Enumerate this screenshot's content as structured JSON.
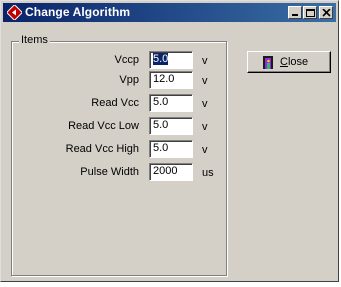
{
  "window": {
    "title": "Change Algorithm",
    "buttons": {
      "minimize": "minimize",
      "maximize": "maximize",
      "close": "close"
    }
  },
  "group": {
    "label": "Items",
    "rows": [
      {
        "label": "Vccp",
        "value": "5.0",
        "unit": "v",
        "selected": true
      },
      {
        "label": "Vpp",
        "value": "12.0",
        "unit": "v",
        "selected": false
      },
      {
        "label": "Read Vcc",
        "value": "5.0",
        "unit": "v",
        "selected": false
      },
      {
        "label": "Read Vcc Low",
        "value": "5.0",
        "unit": "v",
        "selected": false
      },
      {
        "label": "Read Vcc High",
        "value": "5.0",
        "unit": "v",
        "selected": false
      },
      {
        "label": "Pulse Width",
        "value": "2000",
        "unit": "us",
        "selected": false
      }
    ]
  },
  "close_button": {
    "mnemonic": "C",
    "rest": "lose"
  },
  "colors": {
    "title_start": "#0a246a",
    "title_end": "#3a6ea5",
    "face": "#d4d0c8"
  },
  "icons": {
    "app": "diamond-arrow-icon",
    "close_button": "exit-door-icon"
  }
}
